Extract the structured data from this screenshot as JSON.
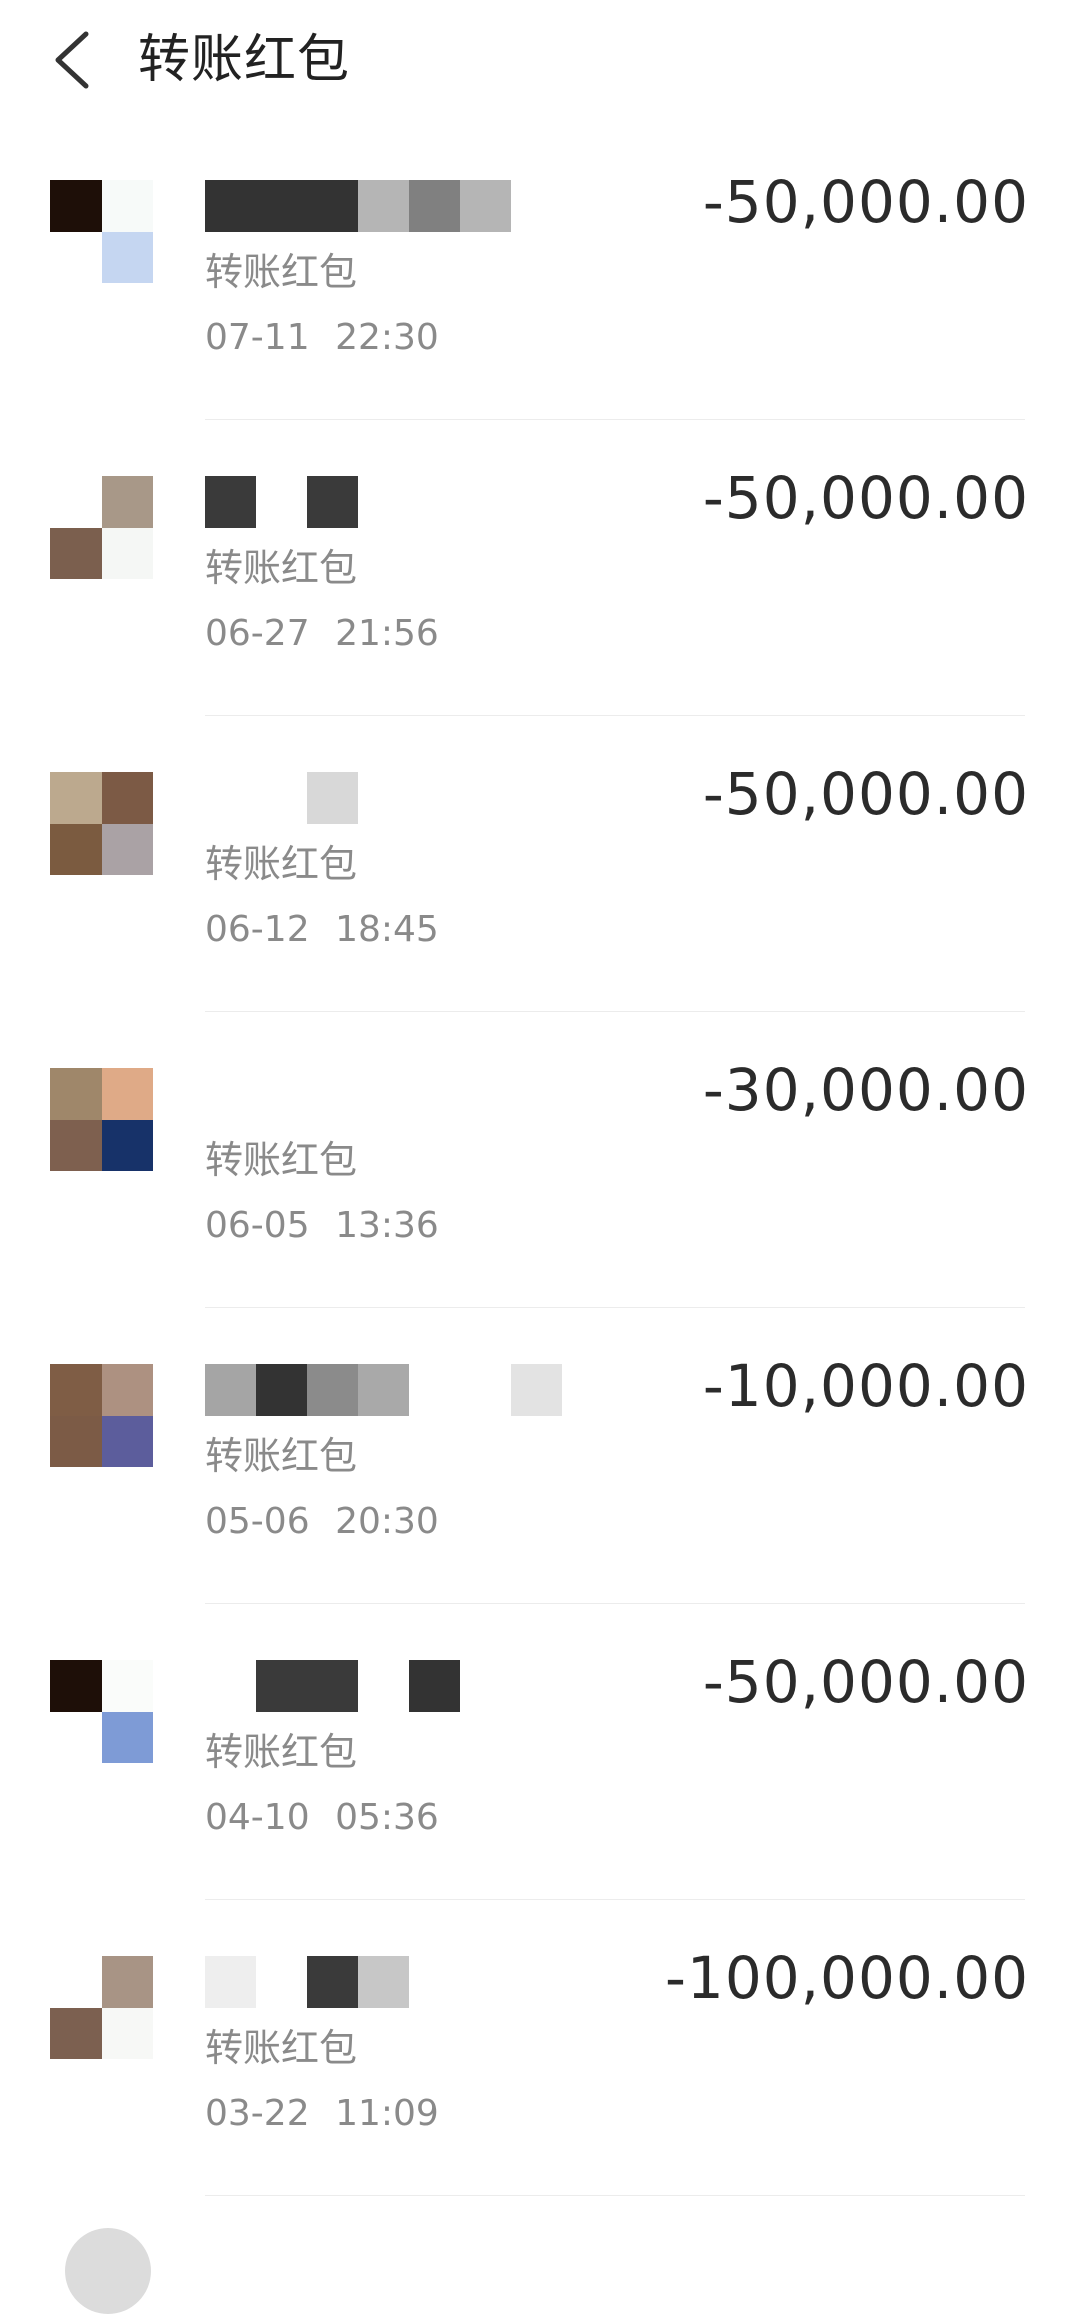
{
  "header": {
    "title": "转账红包"
  },
  "transactions": [
    {
      "subtitle": "转账红包",
      "date": "07-11",
      "time": "22:30",
      "amount": "-50,000.00",
      "avatar_colors": [
        "#1e0f08",
        "#f7faf9",
        "#ffffff",
        "#c5d6f1"
      ],
      "name_colors": [
        "#333333",
        "#333333",
        "#333333",
        "#b5b5b5",
        "#808080",
        "#b5b5b5"
      ]
    },
    {
      "subtitle": "转账红包",
      "date": "06-27",
      "time": "21:56",
      "amount": "-50,000.00",
      "avatar_colors": [
        "#ffffff",
        "#a89888",
        "#7b5f4e",
        "#f5f7f5"
      ],
      "name_colors": [
        "#3a3a3a",
        "#ffffff",
        "#3a3a3a"
      ]
    },
    {
      "subtitle": "转账红包",
      "date": "06-12",
      "time": "18:45",
      "amount": "-50,000.00",
      "avatar_colors": [
        "#bca98e",
        "#7c5a45",
        "#7b5b40",
        "#aaa2a5"
      ],
      "name_colors": [
        "#ffffff",
        "#ffffff",
        "#d8d8d8"
      ]
    },
    {
      "subtitle": "转账红包",
      "date": "06-05",
      "time": "13:36",
      "amount": "-30,000.00",
      "avatar_colors": [
        "#9f876a",
        "#dfaa87",
        "#7e604f",
        "#173269"
      ],
      "name_colors": []
    },
    {
      "subtitle": "转账红包",
      "date": "05-06",
      "time": "20:30",
      "amount": "-10,000.00",
      "avatar_colors": [
        "#7f5d45",
        "#ad9181",
        "#7c5b46",
        "#5c5d9c"
      ],
      "name_colors": [
        "#a5a5a5",
        "#333333",
        "#8b8b8b",
        "#a9a9a9",
        "#ffffff",
        "#ffffff",
        "#e3e3e3"
      ]
    },
    {
      "subtitle": "转账红包",
      "date": "04-10",
      "time": "05:36",
      "amount": "-50,000.00",
      "avatar_colors": [
        "#1e0f08",
        "#fafcfa",
        "#ffffff",
        "#7e9bd6"
      ],
      "name_colors": [
        "#ffffff",
        "#3a3a3a",
        "#3a3a3a",
        "#ffffff",
        "#333333"
      ]
    },
    {
      "subtitle": "转账红包",
      "date": "03-22",
      "time": "11:09",
      "amount": "-100,000.00",
      "avatar_colors": [
        "#ffffff",
        "#a89485",
        "#7c6050",
        "#f7f8f6"
      ],
      "name_colors": [
        "#eeeeee",
        "#ffffff",
        "#3a3a3a",
        "#c7c7c7"
      ]
    }
  ]
}
